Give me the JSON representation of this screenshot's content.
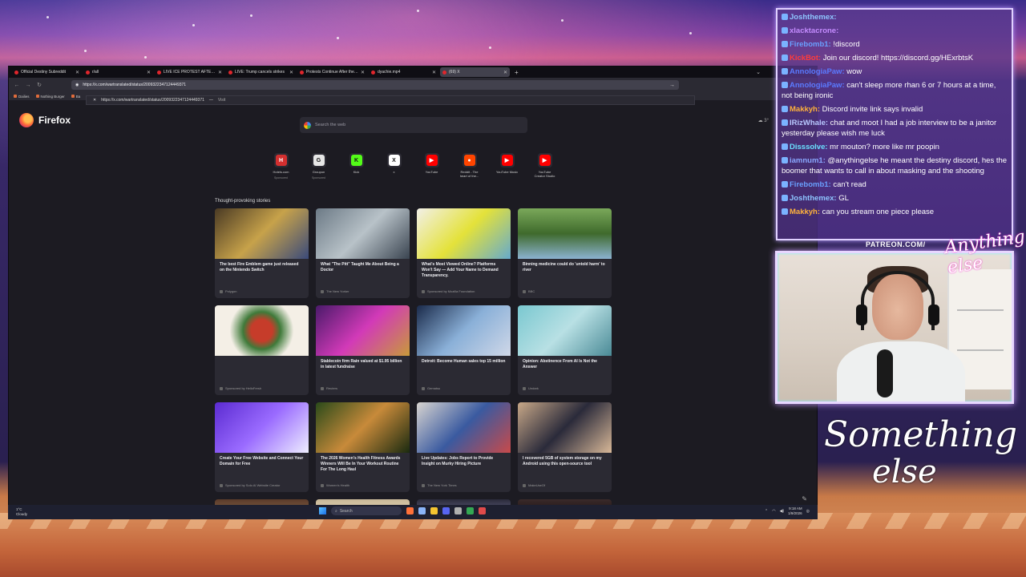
{
  "browser": {
    "tabs": [
      {
        "label": "Official Destiny Subreddit",
        "active": false
      },
      {
        "label": "r/all",
        "active": false
      },
      {
        "label": "LIVE ICE PROTEST AFTER MURI",
        "active": false
      },
      {
        "label": "LIVE: Trump cancels strikes",
        "active": false
      },
      {
        "label": "Protests Continue After the ICE",
        "active": false
      },
      {
        "label": "dyachie.mp4",
        "active": false
      },
      {
        "label": "(69) X",
        "active": true
      }
    ],
    "url": "https://x.com/wartranslated/status/2009322347124449371",
    "suggestion_url": "https://x.com/wartranslated/status/2009322347124449371",
    "suggestion_action": "Visit",
    "bookmarks": [
      "Dailies",
      "Nothing Burger",
      "Ba"
    ],
    "brand": "Firefox",
    "weather_top": "3°",
    "search_placeholder": "Search the web",
    "shortcuts": [
      {
        "title": "Hotels.com",
        "sub": "Sponsored",
        "icon": "H",
        "color": "#d32f2f"
      },
      {
        "title": "Groupon",
        "sub": "Sponsored",
        "icon": "G",
        "color": "#e6e6e6"
      },
      {
        "title": "Kick",
        "sub": "",
        "icon": "K",
        "color": "#53fc18"
      },
      {
        "title": "x",
        "sub": "",
        "icon": "X",
        "color": "#ffffff"
      },
      {
        "title": "YouTube",
        "sub": "",
        "icon": "▶",
        "color": "#ff0000"
      },
      {
        "title": "Reddit - The heart of the...",
        "sub": "",
        "icon": "●",
        "color": "#ff4500"
      },
      {
        "title": "YouTube Music",
        "sub": "",
        "icon": "▶",
        "color": "#ff0000"
      },
      {
        "title": "YouTube Creator Studio",
        "sub": "",
        "icon": "▶",
        "color": "#ff0000"
      }
    ],
    "stories_title": "Thought-provoking stories",
    "stories": [
      {
        "title": "The best Fire Emblem game just released on the Nintendo Switch",
        "source": "Polygon",
        "bg": "linear-gradient(135deg,#4a3a24,#c7a24a,#3a4a7a)"
      },
      {
        "title": "What \"The Pitt\" Taught Me About Being a Doctor",
        "source": "The New Yorker",
        "bg": "linear-gradient(135deg,#6c7a86,#b8c2c8,#3a4450)"
      },
      {
        "title": "What's Most Viewed Online? Platforms Won't Say — Add Your Name to Demand Transparency.",
        "source": "Sponsored by Mozilla Foundation",
        "bg": "linear-gradient(135deg,#f2f0e8,#e4e23a,#6ac)"
      },
      {
        "title": "Binning medicine could do 'untold harm' to river",
        "source": "BBC",
        "bg": "linear-gradient(180deg,#7aa85a,#3f6a2c,#8bb2d0)"
      },
      {
        "title": "",
        "source": "Sponsored by HelloFresh",
        "bg": "radial-gradient(circle,#c63c2a 0 20%,#3f7a3a 35%,#f4efe6 60%)"
      },
      {
        "title": "Stablecoin firm Rain valued at $1.95 billion in latest fundraise",
        "source": "Reuters",
        "bg": "linear-gradient(135deg,#4a1a6a,#d23ab8,#c89a3a)"
      },
      {
        "title": "Detroit: Become Human sales top 15 million",
        "source": "Gematsu",
        "bg": "linear-gradient(135deg,#1a2a4a,#8ab0d8,#d0d8e8)"
      },
      {
        "title": "Opinion: Abstinence From AI Is Not the Answer",
        "source": "Undark",
        "bg": "linear-gradient(135deg,#7ac8d0,#b8e0e4,#4a8a96)"
      },
      {
        "title": "Create Your Free Website and Connect Your Domain for Free",
        "source": "Sponsored by Solo AI Website Creator",
        "bg": "linear-gradient(135deg,#5b2bd1,#9a6bff,#eeeeff)"
      },
      {
        "title": "The 2026 Women's Health Fitness Awards Winners Will Be In Your Workout Routine For The Long Haul",
        "source": "Women's Health",
        "bg": "linear-gradient(135deg,#2a4a1a,#c88a3a,#1a2a10)"
      },
      {
        "title": "Live Updates: Jobs Report to Provide Insight on Murky Hiring Picture",
        "source": "The New York Times",
        "bg": "linear-gradient(135deg,#d8d4d0,#3a5aa0,#c84a4a)"
      },
      {
        "title": "I recovered 5GB of system storage on my Android using this open-source tool",
        "source": "MakeUseOf",
        "bg": "linear-gradient(135deg,#c8a888,#2a2a3a,#d8b898)"
      }
    ],
    "partial_rows": 4
  },
  "taskbar": {
    "weather_temp": "1°C",
    "weather_desc": "Cloudy",
    "search_label": "Search",
    "time": "9:18 AM",
    "date": "1/9/2026"
  },
  "chat": [
    {
      "user": "Joshthemex:",
      "text": "",
      "color": "#8ec5ff"
    },
    {
      "user": "xlacktacrone:",
      "text": "",
      "color": "#c58cff"
    },
    {
      "user": "Firebomb1:",
      "text": "!discord",
      "color": "#6aa0ff"
    },
    {
      "user": "KickBot:",
      "text": "Join our discord! https://discord.gg/HExrbtsK",
      "color": "#ff3b3b"
    },
    {
      "user": "AnnoIogiaPaw:",
      "text": "wow",
      "color": "#5a7aff"
    },
    {
      "user": "AnnoIogiaPaw:",
      "text": "can't sleep more rhan 6 or 7 hours at a time, not being ironic",
      "color": "#5a7aff"
    },
    {
      "user": "Makkyh:",
      "text": "Discord invite link says invalid",
      "color": "#ffb23b"
    },
    {
      "user": "IRizWhale:",
      "text": "chat and moot I had a job interview to be a janitor yesterday please wish me luck",
      "color": "#b8c8ff"
    },
    {
      "user": "Disssolve:",
      "text": "mr mouton? more like mr poopin",
      "color": "#6ae0ff"
    },
    {
      "user": "iamnum1:",
      "text": "@anythingelse he meant the destiny discord, hes the boomer that wants to call in about masking and the shooting",
      "color": "#8aa8ff"
    },
    {
      "user": "Firebomb1:",
      "text": "can't read",
      "color": "#6aa0ff"
    },
    {
      "user": "Joshthemex:",
      "text": "GL",
      "color": "#8ec5ff"
    },
    {
      "user": "Makkyh:",
      "text": "can you stream one piece please",
      "color": "#ffb23b"
    }
  ],
  "overlay": {
    "patreon": "PATREON.COM/",
    "signature": "Anything else",
    "brand_line1": "Something",
    "brand_line2": "else"
  }
}
